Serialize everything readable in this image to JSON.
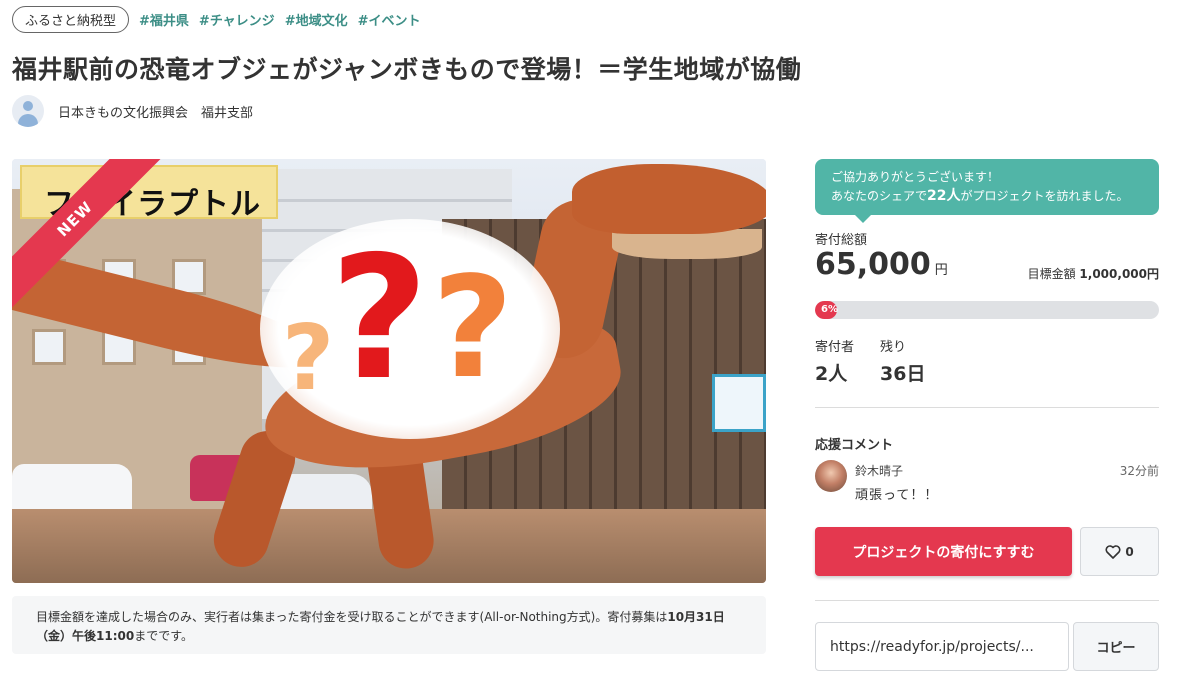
{
  "tags": {
    "category": "ふるさと納税型",
    "hashtags": [
      "#福井県",
      "#チャレンジ",
      "#地域文化",
      "#イベント"
    ]
  },
  "title": "福井駅前の恐竜オブジェがジャンボきもので登場！＝学生地域が協働",
  "owner": {
    "name": "日本きもの文化振興会　福井支部"
  },
  "hero": {
    "ribbon": "NEW",
    "sign_text": "フクイラプトル"
  },
  "note": {
    "text_before": "目標金額を達成した場合のみ、実行者は集まった寄付金を受け取ることができます(All-or-Nothing方式)。寄付募集は",
    "deadline": "10月31日（金）午後11:00",
    "text_after": "までです。"
  },
  "share": {
    "line1": "ご協力ありがとうございます！",
    "prefix": "あなたのシェアで",
    "count": "22人",
    "suffix": "がプロジェクトを訪れました。"
  },
  "funding": {
    "raised_label": "寄付総額",
    "raised": "65,000",
    "unit": "円",
    "goal_label": "目標金額",
    "goal": "1,000,000円",
    "percent_label": "6%",
    "percent": 6
  },
  "stats": {
    "supporters_label": "寄付者",
    "supporters": "2人",
    "remaining_label": "残り",
    "remaining": "36日"
  },
  "comments": {
    "title": "応援コメント",
    "items": [
      {
        "name": "鈴木晴子",
        "time": "32分前",
        "text": "頑張って！！"
      }
    ]
  },
  "actions": {
    "donate_label": "プロジェクトの寄付にすすむ",
    "like_count": "0",
    "url": "https://readyfor.jp/projects/...",
    "copy_label": "コピー"
  },
  "colors": {
    "accent": "#e4384f",
    "teal": "#51b5a7",
    "hashtag": "#3c8e86"
  }
}
